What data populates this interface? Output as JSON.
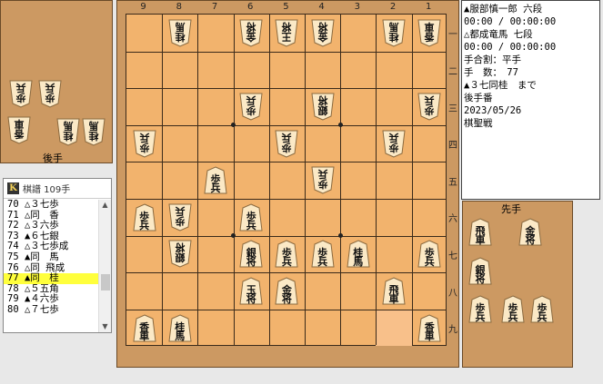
{
  "gote_stand_label": "後手",
  "sente_stand_label": "先手",
  "info_lines": [
    "▲服部慎一郎 六段",
    "00:00 / 00:00:00",
    "△都成竜馬 七段",
    "00:00 / 00:00:00",
    "手合割：平手",
    "手　数：　77",
    "▲３七同桂　まで",
    "後手番",
    "2023/05/26",
    "棋聖戦"
  ],
  "kifu": {
    "logo": "K",
    "title": "棋譜 109手",
    "selected_index": 7,
    "rows": [
      "70 △３七歩",
      "71 △同　香",
      "72 △３六歩",
      "73 ▲６七銀",
      "74 △３七歩成",
      "75 ▲同　馬",
      "76 △同 飛成",
      "77 ▲同　桂",
      "78 △５五角",
      "79 ▲４六歩",
      "80 △７七歩"
    ]
  },
  "file_numbers": [
    "9",
    "8",
    "7",
    "6",
    "5",
    "4",
    "3",
    "2",
    "1"
  ],
  "rank_numbers": [
    "一",
    "二",
    "三",
    "四",
    "五",
    "六",
    "七",
    "八",
    "九"
  ],
  "last_move_highlight": {
    "file": 2,
    "rank": 9
  },
  "board_pieces": [
    {
      "file": 8,
      "rank": 1,
      "side": "gote",
      "chars": [
        "桂",
        "馬"
      ]
    },
    {
      "file": 6,
      "rank": 1,
      "side": "gote",
      "chars": [
        "金",
        "将"
      ]
    },
    {
      "file": 5,
      "rank": 1,
      "side": "gote",
      "chars": [
        "王",
        "将"
      ]
    },
    {
      "file": 4,
      "rank": 1,
      "side": "gote",
      "chars": [
        "金",
        "将"
      ]
    },
    {
      "file": 2,
      "rank": 1,
      "side": "gote",
      "chars": [
        "桂",
        "馬"
      ]
    },
    {
      "file": 1,
      "rank": 1,
      "side": "gote",
      "chars": [
        "香",
        "車"
      ]
    },
    {
      "file": 6,
      "rank": 3,
      "side": "gote",
      "chars": [
        "歩",
        "兵"
      ]
    },
    {
      "file": 4,
      "rank": 3,
      "side": "gote",
      "chars": [
        "銀",
        "将"
      ]
    },
    {
      "file": 1,
      "rank": 3,
      "side": "gote",
      "chars": [
        "歩",
        "兵"
      ]
    },
    {
      "file": 9,
      "rank": 4,
      "side": "gote",
      "chars": [
        "歩",
        "兵"
      ]
    },
    {
      "file": 5,
      "rank": 4,
      "side": "gote",
      "chars": [
        "歩",
        "兵"
      ]
    },
    {
      "file": 2,
      "rank": 4,
      "side": "gote",
      "chars": [
        "歩",
        "兵"
      ]
    },
    {
      "file": 4,
      "rank": 5,
      "side": "gote",
      "chars": [
        "歩",
        "兵"
      ]
    },
    {
      "file": 8,
      "rank": 6,
      "side": "gote",
      "chars": [
        "歩",
        "兵"
      ]
    },
    {
      "file": 8,
      "rank": 7,
      "side": "gote",
      "chars": [
        "銀",
        "将"
      ]
    },
    {
      "file": 7,
      "rank": 5,
      "side": "sente",
      "chars": [
        "歩",
        "兵"
      ]
    },
    {
      "file": 9,
      "rank": 6,
      "side": "sente",
      "chars": [
        "歩",
        "兵"
      ]
    },
    {
      "file": 6,
      "rank": 6,
      "side": "sente",
      "chars": [
        "歩",
        "兵"
      ]
    },
    {
      "file": 6,
      "rank": 7,
      "side": "sente",
      "chars": [
        "銀",
        "将"
      ]
    },
    {
      "file": 5,
      "rank": 7,
      "side": "sente",
      "chars": [
        "歩",
        "兵"
      ]
    },
    {
      "file": 4,
      "rank": 7,
      "side": "sente",
      "chars": [
        "歩",
        "兵"
      ]
    },
    {
      "file": 3,
      "rank": 7,
      "side": "sente",
      "chars": [
        "桂",
        "馬"
      ]
    },
    {
      "file": 1,
      "rank": 7,
      "side": "sente",
      "chars": [
        "歩",
        "兵"
      ]
    },
    {
      "file": 6,
      "rank": 8,
      "side": "sente",
      "chars": [
        "玉",
        "将"
      ]
    },
    {
      "file": 5,
      "rank": 8,
      "side": "sente",
      "chars": [
        "金",
        "将"
      ]
    },
    {
      "file": 2,
      "rank": 8,
      "side": "sente",
      "chars": [
        "飛",
        "車"
      ]
    },
    {
      "file": 9,
      "rank": 9,
      "side": "sente",
      "chars": [
        "香",
        "車"
      ]
    },
    {
      "file": 8,
      "rank": 9,
      "side": "sente",
      "chars": [
        "桂",
        "馬"
      ]
    },
    {
      "file": 1,
      "rank": 9,
      "side": "sente",
      "chars": [
        "香",
        "車"
      ]
    }
  ],
  "gote_hand": [
    {
      "chars": [
        "歩",
        "兵"
      ]
    },
    {
      "chars": [
        "歩",
        "兵"
      ]
    },
    {
      "chars": [
        "香",
        "車"
      ]
    },
    {
      "chars": [
        "桂",
        "馬"
      ]
    },
    {
      "chars": [
        "桂",
        "馬"
      ]
    }
  ],
  "sente_hand": [
    {
      "chars": [
        "飛",
        "車"
      ]
    },
    {
      "chars": [
        "金",
        "将"
      ]
    },
    {
      "chars": [
        "銀",
        "将"
      ]
    },
    {
      "chars": [
        "歩",
        "兵"
      ]
    },
    {
      "chars": [
        "歩",
        "兵"
      ]
    },
    {
      "chars": [
        "歩",
        "兵"
      ]
    }
  ]
}
